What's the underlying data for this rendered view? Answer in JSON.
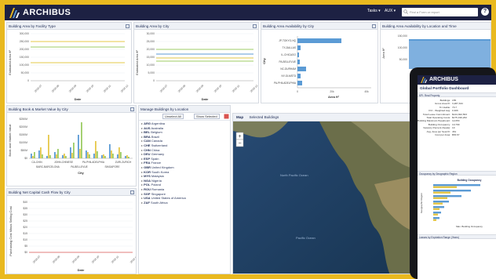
{
  "app": {
    "brand": "ARCHIBUS",
    "menu_tasks": "Tasks ▾",
    "menu_aux": "AUX ▾",
    "search_placeholder": "Find a Form or report",
    "help": "?"
  },
  "colors": {
    "nav": "#1d2143",
    "accent": "#e9b91f",
    "series_blue": "#5b9bd5",
    "series_yellow": "#e6c84a",
    "series_green": "#9ccc65"
  },
  "panels": {
    "p1": {
      "title": "Building Area by Facility Type",
      "ylabel": "Estimated Area ft²",
      "xlabel": "Date",
      "yticks": [
        "300,000",
        "250,000",
        "200,000",
        "150,000",
        "100,000",
        "50,000",
        "0"
      ],
      "xticks": [
        "2018-07",
        "2018-08",
        "2018-09",
        "2018-10",
        "2018-11",
        "2018-12"
      ]
    },
    "p2": {
      "title": "Building Area by City",
      "ylabel": "Estimated Area ft²",
      "xlabel": "Date",
      "yticks": [
        "30,000",
        "25,000",
        "20,000",
        "15,000",
        "10,000",
        "5,000",
        "0"
      ],
      "xticks": [
        "2018-07",
        "2018-08",
        "2018-09",
        "2018-10",
        "2018-11",
        "2018-12"
      ]
    },
    "p3": {
      "title": "Building Area Availability by City",
      "ylabel": "City",
      "xlabel": "Area ft²",
      "categories": [
        "JP-TOKYO-HQ",
        "TX-DALLAS",
        "IL-CHICAGO",
        "PA-BELLEVUE",
        "NC-DURHAM",
        "NY-OLMSTD",
        "PA-PHILADELPHIA"
      ],
      "xticks": [
        "0",
        "20k",
        "40k"
      ]
    },
    "p4": {
      "title": "Building Area Availability by Location and Time",
      "ylabel": "Area ft²",
      "yticks": [
        "150,000",
        "100,000",
        "50,000"
      ]
    },
    "p5": {
      "title": "Building Book & Market Value by City",
      "ylabel": "Book and Market Value",
      "xlabel": "City",
      "yticks": [
        "$250M",
        "$200M",
        "$150M",
        "$100M",
        "$50M",
        "$0"
      ],
      "xticks_top": [
        "CA-CHIN",
        "JOHN-CHINESE",
        "PA-PHILADELPHIA",
        "ZURI-ZURICH"
      ],
      "xticks_bottom": [
        "BARC-BARCELONA",
        "PA-BELLEVUE",
        "SINGAPORE"
      ]
    },
    "p6": {
      "title": "Manage Buildings by Location",
      "btn_unselect": "Unselect All",
      "btn_show": "Show Selected",
      "countries": [
        {
          "code": "ARG",
          "name": "Argentina"
        },
        {
          "code": "AUS",
          "name": "Australia"
        },
        {
          "code": "BEL",
          "name": "Belgium"
        },
        {
          "code": "BRA",
          "name": "Brazil"
        },
        {
          "code": "CAN",
          "name": "Canada"
        },
        {
          "code": "CHE",
          "name": "Switzerland"
        },
        {
          "code": "CHN",
          "name": "China"
        },
        {
          "code": "DEU",
          "name": "Germany"
        },
        {
          "code": "ESP",
          "name": "Spain"
        },
        {
          "code": "FRA",
          "name": "France"
        },
        {
          "code": "GBR",
          "name": "United Kingdom"
        },
        {
          "code": "KOR",
          "name": "South Korea"
        },
        {
          "code": "MYS",
          "name": "Malaysia"
        },
        {
          "code": "NGA",
          "name": "Nigeria"
        },
        {
          "code": "POL",
          "name": "Poland"
        },
        {
          "code": "ROU",
          "name": "Romania"
        },
        {
          "code": "SGP",
          "name": "Singapore"
        },
        {
          "code": "USA",
          "name": "United States of America"
        },
        {
          "code": "ZAF",
          "name": "South Africa"
        }
      ]
    },
    "p7": {
      "title": "Building Net Capital Cash Flow by City",
      "ylabel": "Purchasing Cost Minus Selling Cost",
      "xlabel": "Date",
      "yticks": [
        "$40",
        "$35",
        "$30",
        "$25",
        "$20",
        "$15",
        "$10",
        "$5",
        "$0"
      ],
      "xticks": [
        "2018-07",
        "2018-08",
        "2018-09",
        "2018-10",
        "2018-11",
        "2018-12"
      ]
    },
    "map": {
      "tab_map": "Map",
      "tab_selected": "Selected Buildings",
      "ocean_label": "Pacific Ocean",
      "ocean_label_2": "North Pacific Ocean",
      "zoom_in": "+",
      "zoom_out": "−"
    }
  },
  "mobile": {
    "brand": "ARCHIBUS",
    "title": "Global Portfolio Dashboard",
    "key_header": "KPI: Real Property",
    "kpis": [
      {
        "k": "Buildings:",
        "v": "155"
      },
      {
        "k": "Gross Area ft²:",
        "v": "3,287,344"
      },
      {
        "k": "% Usable:",
        "v": "73.7"
      },
      {
        "k": "FCI - Weighted Avg:",
        "v": "0.406"
      },
      {
        "k": "Total Lease Commitment:",
        "v": "$144,302,563"
      },
      {
        "k": "Total Operating Costs:",
        "v": "$175,199,262"
      },
      {
        "k": "Building Maximum Headcount:",
        "v": "12,053"
      },
      {
        "k": "Building Occupancy:",
        "v": "10,799"
      },
      {
        "k": "Vacancy Percent (Seats):",
        "v": "10"
      },
      {
        "k": "Avg. Area per Seat ft²:",
        "v": "461"
      },
      {
        "k": "Cost per Area:",
        "v": "$53.67"
      }
    ],
    "occ_header": "Occupancy by Geographic Region",
    "occ_chart_title": "Building Occupancy",
    "occ_ylabel": "Geographic Region",
    "occ_xlabel": "Max. Building Occupancy",
    "lease_header": "Leases by Expiration Range (Years)"
  }
}
